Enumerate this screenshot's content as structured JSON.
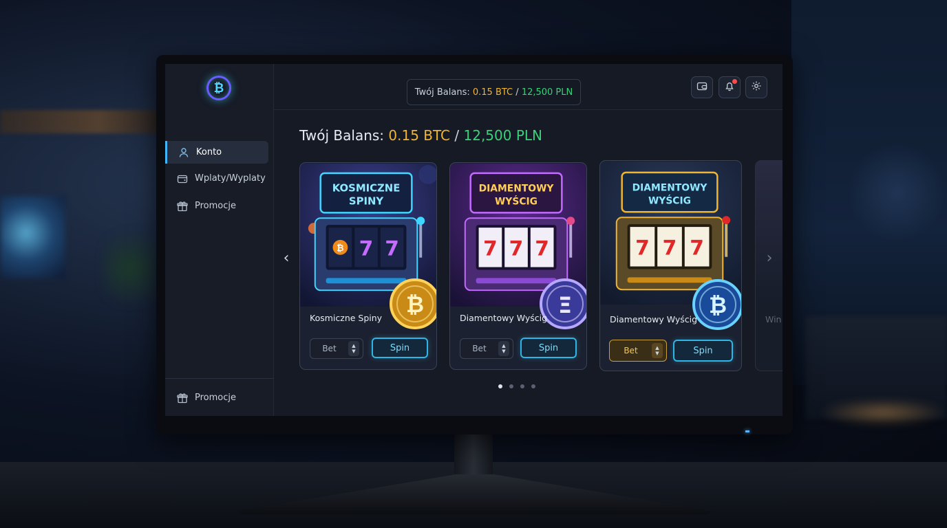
{
  "header": {
    "balance_label": "Twój Balans:",
    "btc": "0.15 BTC",
    "separator": "/",
    "pln": "12,500 PLN",
    "buttons": [
      "wallet-icon",
      "bell-icon",
      "gear-icon"
    ]
  },
  "sidebar": {
    "logo": "₿",
    "items": [
      {
        "label": "Konto",
        "icon": "user-icon",
        "active": true
      },
      {
        "label": "Wplaty/Wyplaty",
        "icon": "wallet-icon",
        "active": false
      },
      {
        "label": "Promocje",
        "icon": "gift-icon",
        "active": false
      }
    ],
    "footer_item": {
      "label": "Promocje",
      "icon": "gift-icon"
    }
  },
  "main": {
    "heading_label": "Twój Balans:",
    "heading_btc": "0.15 BTC",
    "heading_sep": "/",
    "heading_pln": "12,500 PLN",
    "games": [
      {
        "banner_line1": "KOSMICZNE",
        "banner_line2": "SPINY",
        "title": "Kosmiczne Spiny",
        "coin": "₿",
        "bet_label": "Bet",
        "spin_label": "Spin",
        "accent": "#2fb6e6"
      },
      {
        "banner_line1": "DIAMENTOWY",
        "banner_line2": "WYŚCIG",
        "title": "Diamentowy Wyścig",
        "coin": "Ξ",
        "bet_label": "Bet",
        "spin_label": "Spin",
        "accent": "#9b5cff"
      },
      {
        "banner_line1": "DIAMENTOWY",
        "banner_line2": "WYŚCIG",
        "title": "Diamentowy Wyścig",
        "coin": "₿",
        "bet_label": "Bet",
        "spin_label": "Spin",
        "accent": "#f2b531"
      }
    ],
    "partial_card_title": "Win",
    "carousel": {
      "pages": 4,
      "active": 1
    }
  },
  "colors": {
    "btc": "#f2b531",
    "pln": "#39d27a",
    "accent": "#2fb6e6"
  }
}
